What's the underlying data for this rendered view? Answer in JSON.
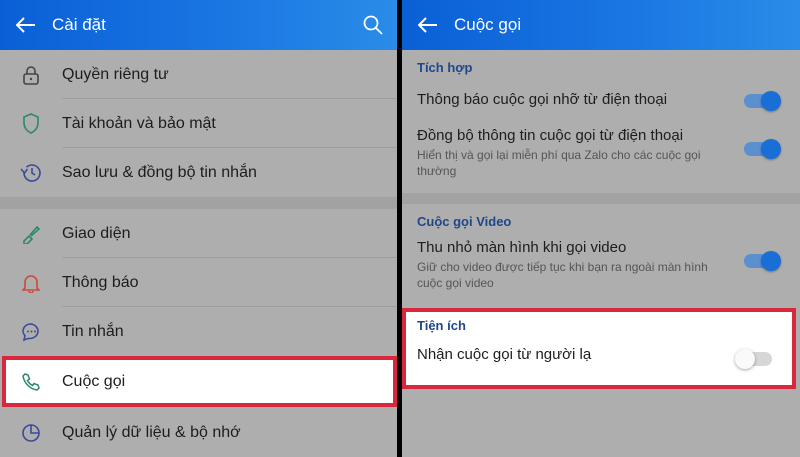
{
  "left": {
    "title": "Cài đặt",
    "groups": [
      {
        "items": [
          {
            "label": "Quyền riêng tư",
            "icon": "lock-icon"
          },
          {
            "label": "Tài khoản và bảo mật",
            "icon": "shield-icon"
          },
          {
            "label": "Sao lưu & đồng bộ tin nhắn",
            "icon": "history-icon"
          }
        ]
      },
      {
        "items": [
          {
            "label": "Giao diện",
            "icon": "paintbrush-icon"
          },
          {
            "label": "Thông báo",
            "icon": "bell-icon"
          },
          {
            "label": "Tin nhắn",
            "icon": "chat-bubble-icon"
          },
          {
            "label": "Cuộc gọi",
            "icon": "phone-icon",
            "highlighted": true
          },
          {
            "label": "Quản lý dữ liệu & bộ nhớ",
            "icon": "pie-chart-icon"
          }
        ]
      }
    ]
  },
  "right": {
    "title": "Cuộc gọi",
    "sections": [
      {
        "title": "Tích hợp",
        "settings": [
          {
            "title": "Thông báo cuộc gọi nhỡ từ điện thoại",
            "desc": "",
            "on": true
          },
          {
            "title": "Đồng bộ thông tin cuộc gọi từ điện thoại",
            "desc": "Hiển thị và gọi lại miễn phí qua Zalo cho các cuộc gọi thường",
            "on": true
          }
        ]
      },
      {
        "title": "Cuộc gọi Video",
        "settings": [
          {
            "title": "Thu nhỏ màn hình khi gọi video",
            "desc": "Giữ cho video được tiếp tục khi bạn ra ngoài màn hình cuộc gọi video",
            "on": true
          }
        ]
      },
      {
        "title": "Tiện ích",
        "highlighted": true,
        "settings": [
          {
            "title": "Nhận cuộc gọi từ người lạ",
            "desc": "",
            "on": false
          }
        ]
      }
    ]
  },
  "colors": {
    "accent": "#1a6fd6",
    "highlight_border": "#d9283b",
    "section_title": "#20468c"
  }
}
